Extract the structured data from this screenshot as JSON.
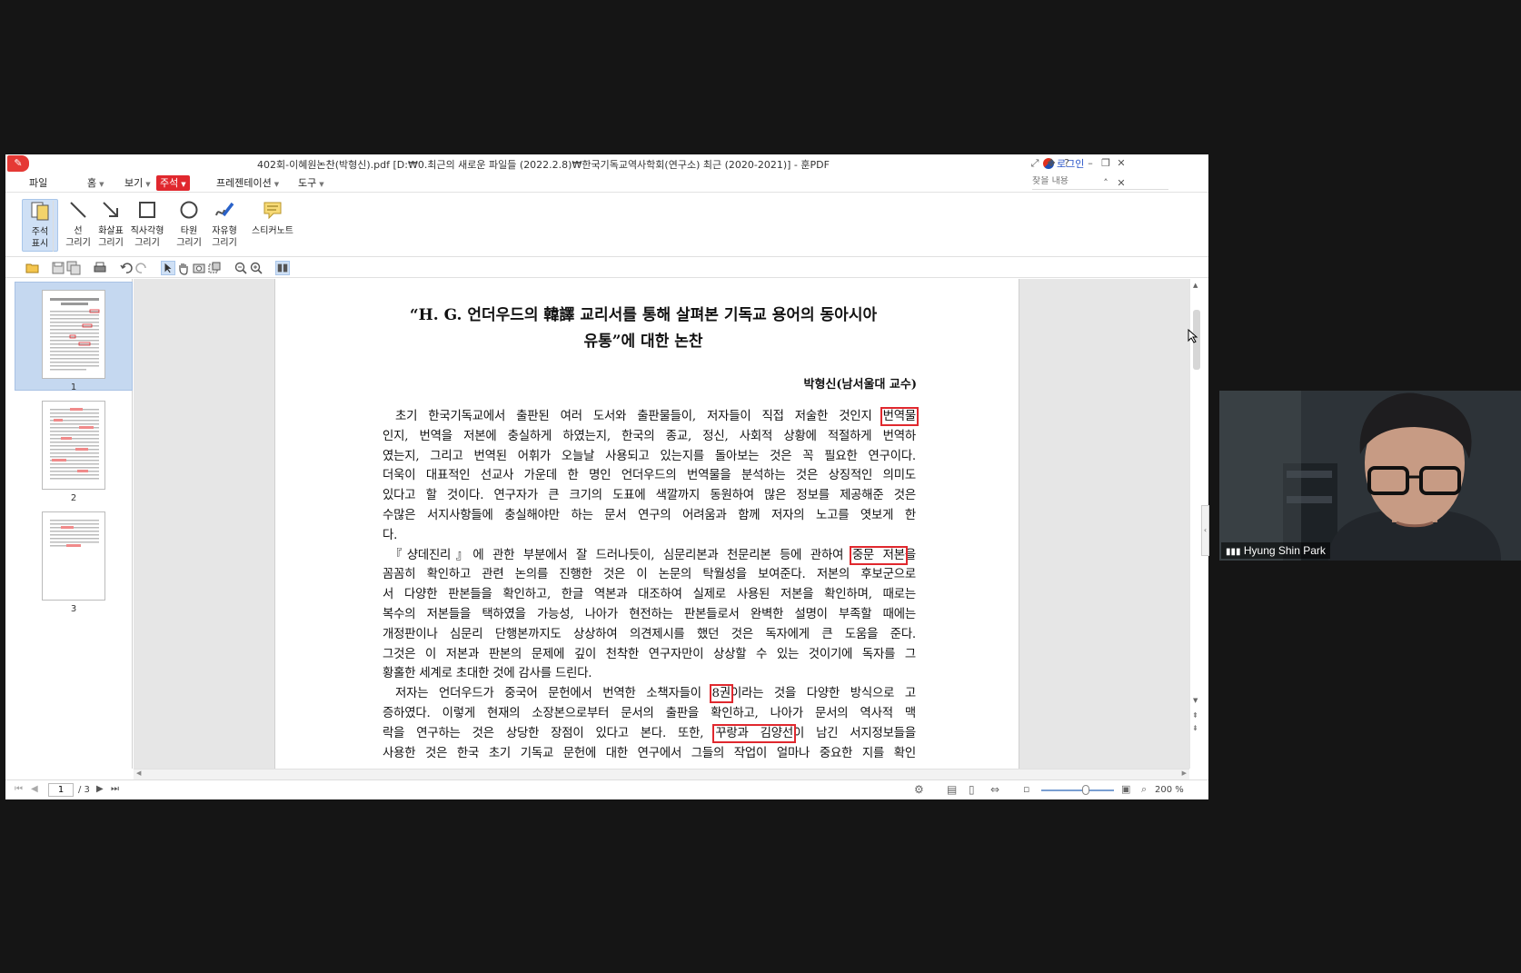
{
  "window": {
    "title": "402회-이혜원논찬(박형신).pdf [D:₩0.최근의 새로운 파일들 (2022.2.8)₩한국기독교역사학회(연구소) 최근 (2020-2021)] - 훈PDF",
    "login_label": "로그인",
    "help_label": "?"
  },
  "menu": {
    "file": "파일",
    "home": "홈",
    "view": "보기",
    "annotate": "주석",
    "presentation": "프레젠테이션",
    "tools": "도구",
    "find_placeholder": "찾을 내용"
  },
  "ribbon": {
    "show_annotations": [
      "주석",
      "표시"
    ],
    "line": [
      "선",
      "그리기"
    ],
    "arrow": [
      "화살표",
      "그리기"
    ],
    "rectangle": [
      "직사각형",
      "그리기"
    ],
    "ellipse": [
      "타원",
      "그리기"
    ],
    "freehand": [
      "자유형",
      "그리기"
    ],
    "sticky_note": "스티커노트"
  },
  "thumbnails": [
    {
      "label": "1",
      "selected": true
    },
    {
      "label": "2",
      "selected": false
    },
    {
      "label": "3",
      "selected": false
    }
  ],
  "document": {
    "title_line1": "“H. G. 언더우드의 韓譯 교리서를 통해 살펴본 기독교 용어의 동아시아",
    "title_line2": "유통”에 대한 논찬",
    "author": "박형신(남서울대 교수)",
    "p1_l1_a": "초기 한국기독교에서 출판된 여러 도서와 출판물들이, 저자들이 직접 저술한 것인지 ",
    "p1_l1_hl": "번역물",
    "p1_l2": "인지, 번역을 저본에 충실하게 하였는지, 한국의 종교, 정신, 사회적 상황에 적절하게 번역하",
    "p1_l3": "였는지, 그리고 번역된 어휘가 오늘날 사용되고 있는지를 돌아보는 것은 꼭 필요한 연구이다.",
    "p1_l4": "더욱이 대표적인 선교사 가운데 한 명인 언더우드의 번역물을 분석하는 것은 상징적인 의미도",
    "p1_l5": "있다고 할 것이다. 연구자가 큰 크기의 도표에 색깔까지 동원하여 많은 정보를 제공해준 것은",
    "p1_l6": "수많은 서지사항들에 충실해야만 하는 문서 연구의 어려움과 함께 저자의 노고를 엿보게 한",
    "p1_l7": "다.",
    "p2_l1_a": "『샹데진리』에 관한 부분에서 잘 드러나듯이, 심문리본과 천문리본 등에 관하여 ",
    "p2_l1_hl": "중문 저본",
    "p2_l1_b": "을",
    "p2_l2": "꼼꼼히 확인하고 관련 논의를 진행한 것은 이 논문의 탁월성을 보여준다. 저본의 후보군으로",
    "p2_l3": "서 다양한 판본들을 확인하고, 한글 역본과 대조하여 실제로 사용된 저본을 확인하며, 때로는",
    "p2_l4": "복수의 저본들을 택하였을 가능성, 나아가 현전하는 판본들로서 완벽한 설명이 부족할 때에는",
    "p2_l5": "개정판이나 심문리 단행본까지도 상상하여 의견제시를 했던 것은 독자에게 큰 도움을 준다.",
    "p2_l6": "그것은 이 저본과 판본의 문제에 깊이 천착한 연구자만이 상상할 수 있는 것이기에 독자를 그",
    "p2_l7": "황홀한 세계로 초대한 것에 감사를 드린다.",
    "p3_l1_a": "저자는 언더우드가 중국어 문헌에서 번역한 소책자들이 ",
    "p3_l1_hl": "8권",
    "p3_l1_b": "이라는 것을 다양한 방식으로 고",
    "p3_l2": "증하였다. 이렇게 현재의 소장본으로부터 문서의 출판을 확인하고, 나아가 문서의 역사적 맥",
    "p3_l3_a": "락을 연구하는 것은 상당한 장점이 있다고 본다. 또한, ",
    "p3_l3_hl": "꾸랑과 김양선",
    "p3_l3_b": "이 남긴 서지정보들을",
    "p3_l4": "사용한 것은 한국 초기 기독교 문헌에 대한 연구에서 그들의 작업이 얼마나 중요한 지를 확인"
  },
  "status": {
    "current_page": "1",
    "total_pages": "/ 3",
    "zoom": "200 %"
  },
  "video": {
    "participant_name": "Hyung Shin Park"
  },
  "colors": {
    "accent": "#e0282e",
    "selection": "#cfe0f5"
  }
}
